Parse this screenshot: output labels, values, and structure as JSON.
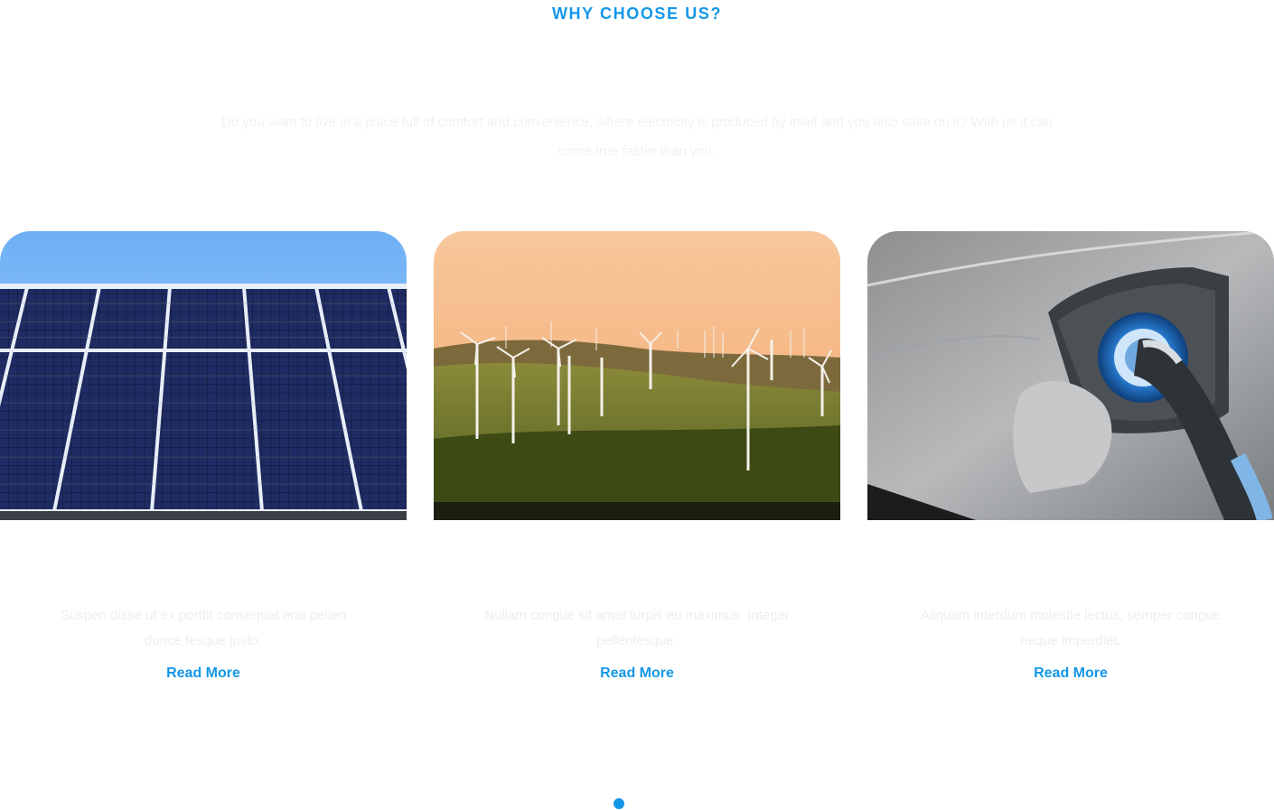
{
  "section": {
    "eyebrow": "WHY CHOOSE US?",
    "intro": "Do you want to live in a place full of comfort and convenience, where electricity is produced by itself and you also save on it? With us it can come true faster than you."
  },
  "cards": [
    {
      "image": "solar-panels-photo",
      "text": "Suspen disse ut ex porttit consequat erat pellen donce tesque justo.",
      "link": "Read More"
    },
    {
      "image": "wind-turbines-photo",
      "text": "Nullam congue sit amet turpis eu maximus. Integer pellentesque.",
      "link": "Read More"
    },
    {
      "image": "ev-charger-photo",
      "text": "Aliquam interdum molestie lectus, semper congue neque imperdiet.",
      "link": "Read More"
    }
  ],
  "carousel": {
    "active_dot": 1
  },
  "colors": {
    "accent": "#1397e8",
    "background": "#ffffff"
  }
}
